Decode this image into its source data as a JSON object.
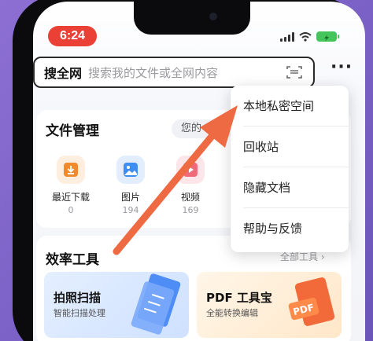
{
  "status_bar": {
    "time": "6:24"
  },
  "search": {
    "brand": "搜全网",
    "placeholder": "搜索我的文件或全网内容"
  },
  "file_card": {
    "title": "文件管理",
    "chip": "您的",
    "items": [
      {
        "label": "最近下载",
        "count": "0",
        "color": "#f18a2d"
      },
      {
        "label": "图片",
        "count": "194",
        "color": "#3e8df0"
      },
      {
        "label": "视频",
        "count": "169",
        "color": "#f06a7a"
      }
    ]
  },
  "tools_card": {
    "title": "效率工具",
    "link": "全部工具 ›",
    "tools": [
      {
        "name": "拍照扫描",
        "sub": "智能扫描处理"
      },
      {
        "name": "PDF 工具宝",
        "sub": "全能转换编辑"
      }
    ]
  },
  "menu": {
    "items": [
      "本地私密空间",
      "回收站",
      "隐藏文档",
      "帮助与反馈"
    ]
  },
  "colors": {
    "accent": "#ea4036",
    "arrow": "#ee6a43",
    "battery": "#43c55b"
  }
}
